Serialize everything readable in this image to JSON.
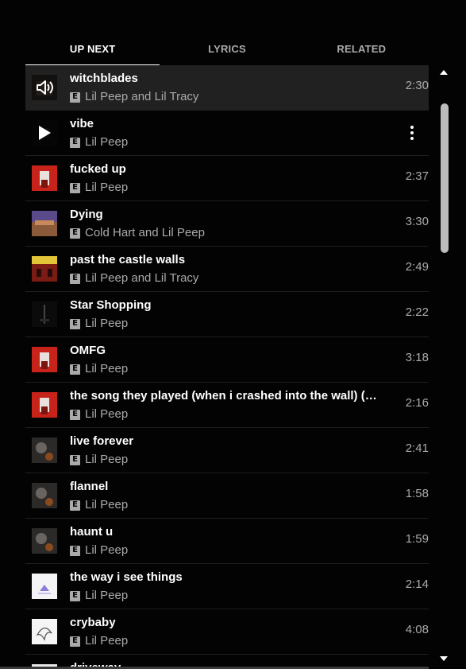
{
  "tabs": [
    {
      "label": "UP NEXT"
    },
    {
      "label": "LYRICS"
    },
    {
      "label": "RELATED"
    }
  ],
  "explicit_badge": "E",
  "queue": [
    {
      "title": "witchblades",
      "artist": "Lil Peep and Lil Tracy",
      "duration": "2:30",
      "state": "playing"
    },
    {
      "title": "vibe",
      "artist": "Lil Peep",
      "duration": "",
      "state": "hover"
    },
    {
      "title": "fucked up",
      "artist": "Lil Peep",
      "duration": "2:37"
    },
    {
      "title": "Dying",
      "artist": "Cold Hart and Lil Peep",
      "duration": "3:30"
    },
    {
      "title": "past the castle walls",
      "artist": "Lil Peep and Lil Tracy",
      "duration": "2:49"
    },
    {
      "title": "Star Shopping",
      "artist": "Lil Peep",
      "duration": "2:22"
    },
    {
      "title": "OMFG",
      "artist": "Lil Peep",
      "duration": "3:18"
    },
    {
      "title": "the song they played (when i crashed into the wall) (fe...",
      "artist": "Lil Peep",
      "duration": "2:16"
    },
    {
      "title": "live forever",
      "artist": "Lil Peep",
      "duration": "2:41"
    },
    {
      "title": "flannel",
      "artist": "Lil Peep",
      "duration": "1:58"
    },
    {
      "title": "haunt u",
      "artist": "Lil Peep",
      "duration": "1:59"
    },
    {
      "title": "the way i see things",
      "artist": "Lil Peep",
      "duration": "2:14"
    },
    {
      "title": "crybaby",
      "artist": "Lil Peep",
      "duration": "4:08"
    },
    {
      "title": "driveway",
      "artist": "",
      "duration": ""
    }
  ],
  "icons": {
    "playing": "speaker-icon",
    "hover": "play-icon",
    "menu": "more-vert-icon",
    "scroll_up": "scroll-up-arrow-icon",
    "scroll_down": "scroll-down-arrow-icon"
  },
  "colors": {
    "background": "#030303",
    "playing_row": "#212121",
    "secondary_text": "#aaaaaa"
  }
}
